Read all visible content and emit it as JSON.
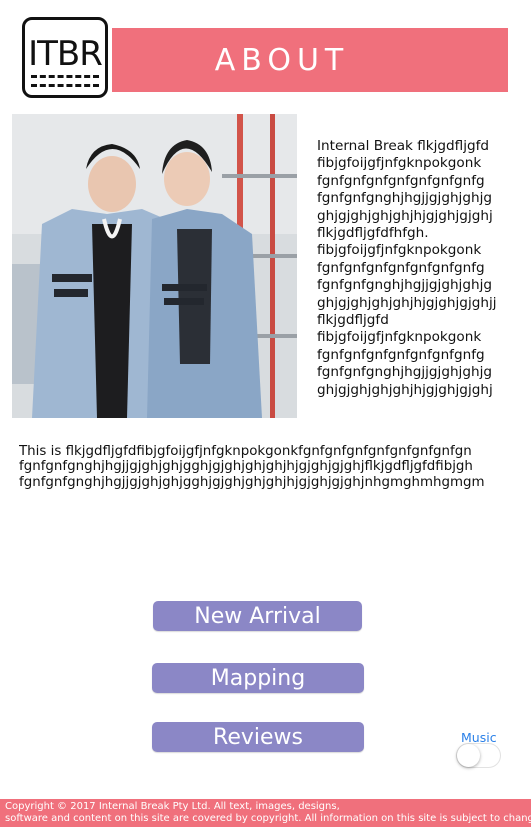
{
  "logo": {
    "text": "ITBR"
  },
  "header": {
    "title": "ABOUT"
  },
  "photo": {
    "description_icon": "photo-image"
  },
  "side_text": {
    "lines": [
      "Internal Break flkjgdfljgfd",
      "fibjgfoijgfjnfgknpokgonk",
      "fgnfgnfgnfgnfgnfgnfgnfg",
      "fgnfgnfgnghjhgjjgjghjghjg",
      "ghjgjghjghjghjhjgjghjgjghj",
      "flkjgdfljgfdfhfgh.",
      "fibjgfoijgfjnfgknpokgonk",
      "fgnfgnfgnfgnfgnfgnfgnfg",
      "fgnfgnfgnghjhgjjgjghjghjg",
      "ghjgjghjghjghjhjgjghjgjghjj",
      "flkjgdfljgfd",
      "fibjgfoijgfjnfgknpokgonk",
      "fgnfgnfgnfgnfgnfgnfgnfg",
      "fgnfgnfgnghjhgjjgjghjghjg",
      "ghjgjghjghjghjhjgjghjgjghj"
    ]
  },
  "body_text": {
    "lines": [
      "This is flkjgdfljgfdfibjgfoijgfjnfgknpokgonkfgnfgnfgnfgnfgnfgnfgnfgn",
      "fgnfgnfgnghjhgjjgjghjghjgghjgjghjghjghjhjgjghjgjghjflkjgdfljgfdfibjgh",
      "fgnfgnfgnghjhgjjgjghjghjgghjgjghjghjghjhjgjghjgjghjnhgmghmhgmgm"
    ]
  },
  "nav": {
    "new_arrival": "New Arrival",
    "mapping": "Mapping",
    "reviews": "Reviews"
  },
  "music": {
    "label": "Music",
    "enabled": false
  },
  "footer": {
    "line1": "Copyright © 2017 Internal Break Pty Ltd. All text, images, designs,",
    "line2": "software and content on this site are covered by copyright. All information on this site is subject to change."
  },
  "colors": {
    "accent_pink": "#f0707c",
    "button_purple": "#8b87c6",
    "music_blue": "#2a80e8"
  }
}
